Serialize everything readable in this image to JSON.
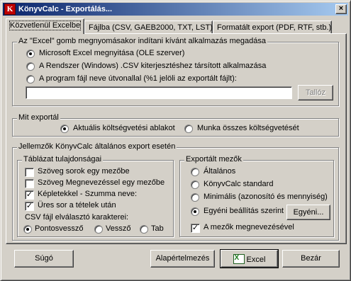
{
  "window": {
    "title": "KönyvCalc - Exportálás...",
    "icon_text": "K",
    "close_label": "×"
  },
  "tabs": [
    {
      "label": "Közvetlenül Excelbe",
      "active": true
    },
    {
      "label": "Fájlba (CSV, GAEB2000, TXT, LST)",
      "active": false
    },
    {
      "label": "Formatált export (PDF, RTF, stb.)",
      "active": false
    }
  ],
  "excel_group": {
    "title": "Az \"Excel\" gomb megnyomásakor indítani kívánt alkalmazás megadása",
    "options": [
      {
        "label": "Microsoft Excel megnyitása (OLE szerver)",
        "selected": true
      },
      {
        "label": "A Rendszer (Windows) .CSV kiterjesztéshez társított alkalmazása",
        "selected": false
      },
      {
        "label": "A program fájl neve útvonallal (%1 jelöli az exportált fájlt):",
        "selected": false
      }
    ],
    "path_value": "",
    "browse_label": "Tallóz"
  },
  "export_what": {
    "title": "Mit exportál",
    "options": [
      {
        "label": "Aktuális költségvetési ablakot",
        "selected": true
      },
      {
        "label": "Munka összes költségvetését",
        "selected": false
      }
    ]
  },
  "general": {
    "title": "Jellemzők KönyvCalc általános export esetén",
    "table_props": {
      "title": "Táblázat tulajdonságai",
      "checks": [
        {
          "label": "Szöveg sorok egy mezőbe",
          "checked": false
        },
        {
          "label": "Szöveg Megnevezéssel egy mezőbe",
          "checked": false
        },
        {
          "label": "Képletekkel - Szumma neve:",
          "checked": true
        },
        {
          "label": "Üres sor a tételek után",
          "checked": true
        }
      ],
      "separator_label": "CSV fájl elválasztó karakterei:",
      "separators": [
        {
          "label": "Pontosvessző",
          "selected": true
        },
        {
          "label": "Vessző",
          "selected": false
        },
        {
          "label": "Tab",
          "selected": false
        }
      ]
    },
    "exported_fields": {
      "title": "Exportált mezők",
      "options": [
        {
          "label": "Általános",
          "selected": false
        },
        {
          "label": "KönyvCalc standard",
          "selected": false
        },
        {
          "label": "Minimális (azonosító és mennyiség)",
          "selected": false
        },
        {
          "label": "Egyéni beállítás szerint",
          "selected": true
        }
      ],
      "custom_button": "Egyéni...",
      "names_check": {
        "label": "A mezők megnevezésével",
        "checked": true
      }
    }
  },
  "footer": {
    "help": "Súgó",
    "defaults": "Alapértelmezés",
    "excel": "Excel",
    "close": "Bezár"
  },
  "colors": {
    "face": "#d4d0c8",
    "titlebar_start": "#0a246a",
    "titlebar_end": "#a6caf0"
  }
}
